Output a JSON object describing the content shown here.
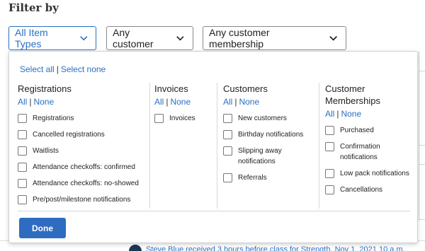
{
  "title": "Filter by",
  "dropdowns": {
    "item_types": "All Item Types",
    "customer": "Any customer",
    "membership": "Any customer membership"
  },
  "panel": {
    "select_all": "Select all",
    "select_separator": "|",
    "select_none": "Select none",
    "all_label": "All",
    "none_label": "None",
    "link_separator": "|",
    "columns": [
      {
        "heading": "Registrations",
        "options": [
          "Registrations",
          "Cancelled registrations",
          "Waitlists",
          "Attendance checkoffs: confirmed",
          "Attendance checkoffs: no-showed",
          "Pre/post/milestone notifications"
        ]
      },
      {
        "heading": "Invoices",
        "options": [
          "Invoices"
        ]
      },
      {
        "heading": "Customers",
        "options": [
          "New customers",
          "Birthday notifications",
          "Slipping away notifications",
          "Referrals"
        ]
      },
      {
        "heading": "Customer Memberships",
        "options": [
          "Purchased",
          "Confirmation notifications",
          "Low pack notifications",
          "Cancellations"
        ]
      }
    ],
    "done_label": "Done"
  },
  "background": {
    "activity_text": "Steve Blue received 3 hours before class for Strength, Nov 1, 2021 10 a.m."
  },
  "colors": {
    "accent": "#2a6fc4",
    "button": "#2e6cc1"
  }
}
